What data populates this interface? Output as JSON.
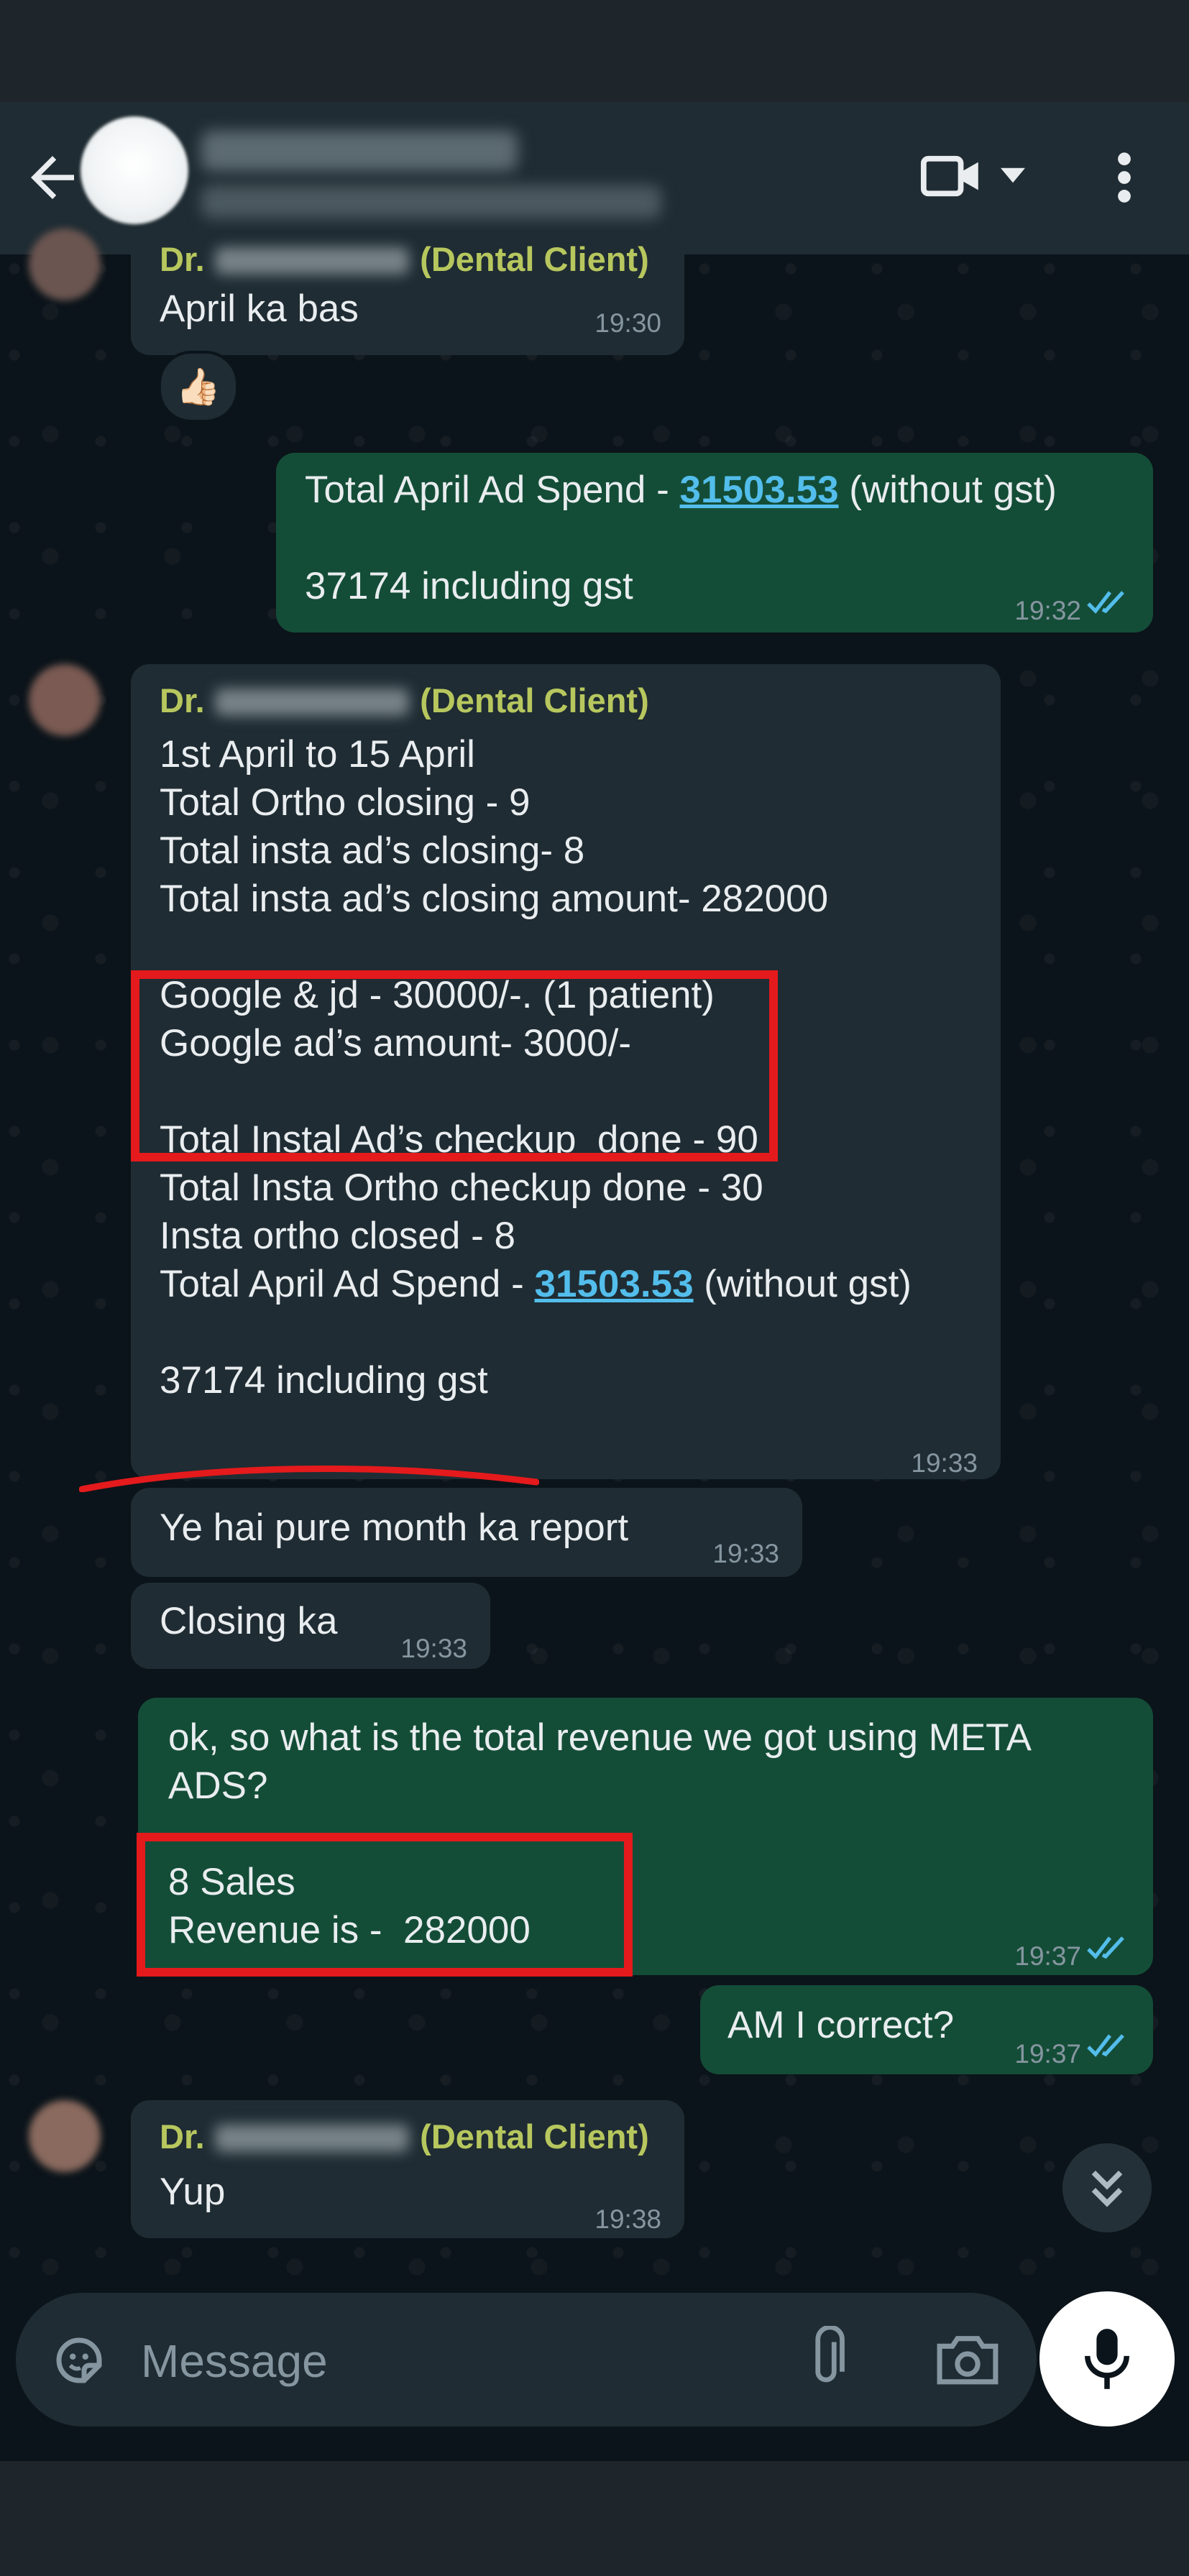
{
  "header": {
    "back_icon": "arrow-left-icon",
    "video_icon": "video-call-icon",
    "dropdown_icon": "caret-down-icon",
    "menu_icon": "more-vert-icon"
  },
  "contact": {
    "name_prefix": "Dr.",
    "role": "(Dental Client)"
  },
  "messages": [
    {
      "id": "m1",
      "text": "April ka bas",
      "time": "19:30",
      "reaction": "👍🏻"
    },
    {
      "id": "m2",
      "prefix": "Total April Ad Spend - ",
      "link": "31503.53",
      "suffix": " (without gst)",
      "line2": "37174 including gst",
      "time": "19:32"
    },
    {
      "id": "m3",
      "lines": [
        "1st April to 15 April",
        "Total Ortho closing - 9",
        "Total insta ad’s closing- 8",
        "Total insta ad’s closing amount- 282000",
        "",
        "Google & jd - 30000/-. (1 patient)",
        "Google ad’s amount- 3000/-",
        "",
        "Total Instal Ad’s checkup  done - 90",
        "Total Insta Ortho checkup done - 30",
        "Insta ortho closed - 8"
      ],
      "spend_prefix": "Total April Ad Spend - ",
      "spend_link": "31503.53",
      "spend_suffix": " (without gst)",
      "last_line": "37174 including gst",
      "time": "19:33"
    },
    {
      "id": "m4",
      "text": "Ye hai pure month ka report",
      "time": "19:33"
    },
    {
      "id": "m5",
      "text": "Closing ka",
      "time": "19:33"
    },
    {
      "id": "m6",
      "lines": [
        "ok, so what is the total revenue we got using META",
        "ADS?",
        "",
        "8 Sales",
        "Revenue is -  282000"
      ],
      "time": "19:37"
    },
    {
      "id": "m7",
      "text": "AM I correct?",
      "time": "19:37"
    },
    {
      "id": "m8",
      "text": "Yup",
      "time": "19:38"
    }
  ],
  "composer": {
    "placeholder": "Message",
    "emoji_icon": "emoji-sticker-icon",
    "attach_icon": "paperclip-icon",
    "camera_icon": "camera-icon",
    "mic_icon": "microphone-icon"
  },
  "scroll_icon": "double-chevron-down-icon",
  "colors": {
    "chat_bg": "#0b141a",
    "incoming_bubble": "#1f2c33",
    "outgoing_bubble": "#144d37",
    "sender_name": "#b7c75e",
    "link": "#53bdeb",
    "read_ticks": "#53bdeb",
    "annotation_red": "#e41a1c"
  }
}
